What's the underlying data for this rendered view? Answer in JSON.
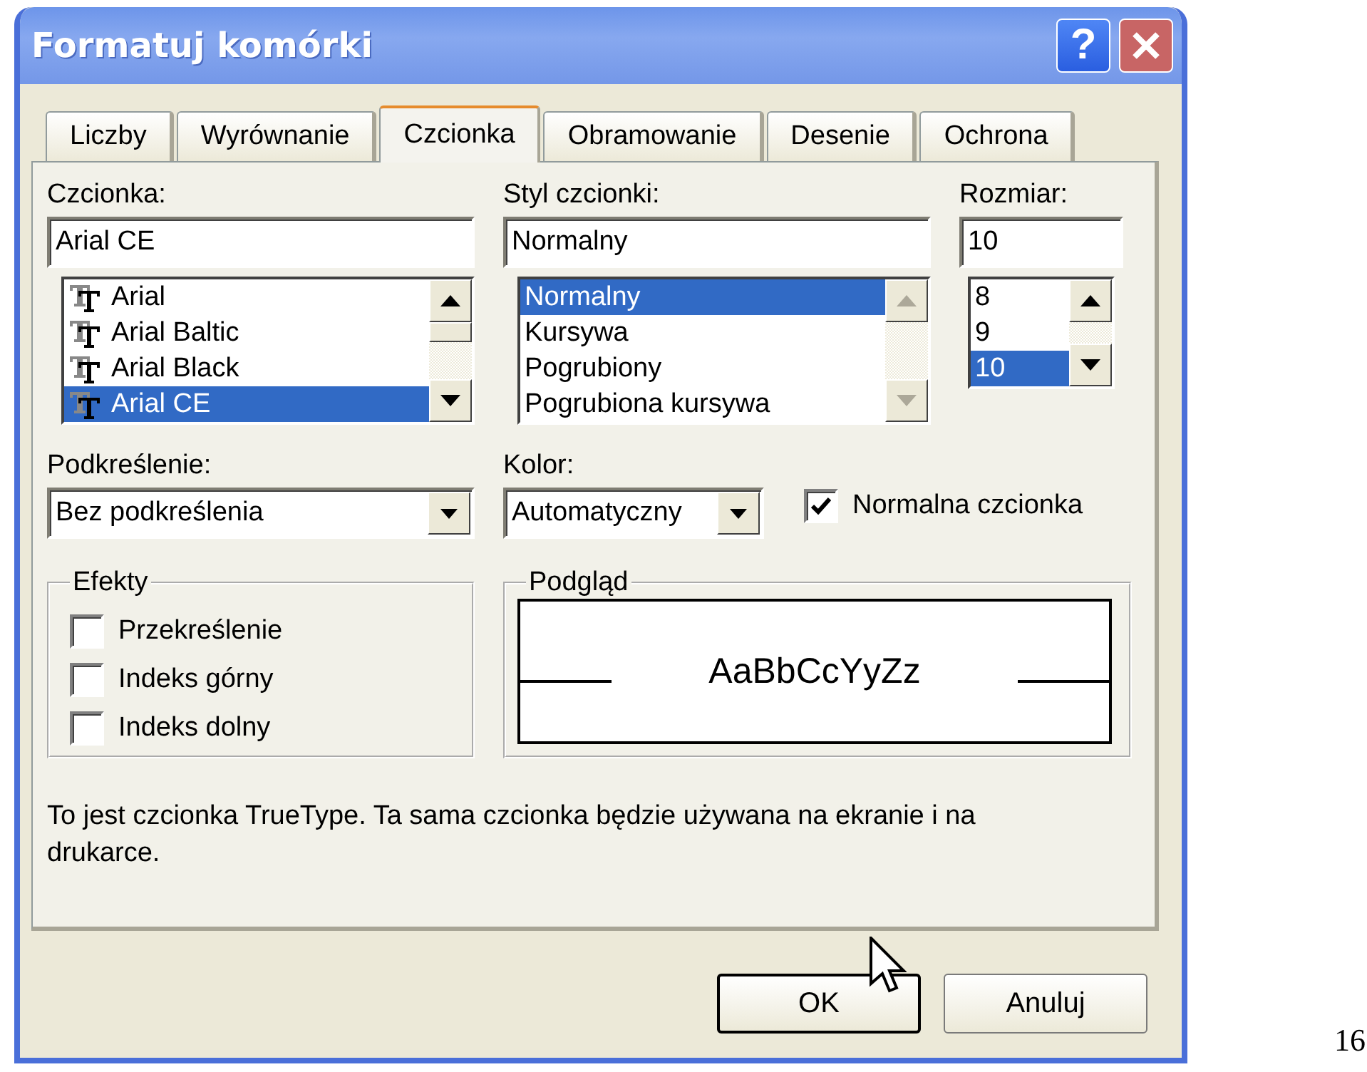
{
  "window": {
    "title": "Formatuj komórki",
    "help_button": "?"
  },
  "tabs": [
    {
      "label": "Liczby",
      "selected": false
    },
    {
      "label": "Wyrównanie",
      "selected": false
    },
    {
      "label": "Czcionka",
      "selected": true
    },
    {
      "label": "Obramowanie",
      "selected": false
    },
    {
      "label": "Desenie",
      "selected": false
    },
    {
      "label": "Ochrona",
      "selected": false
    }
  ],
  "font": {
    "label": "Czcionka:",
    "value": "Arial CE",
    "scroll_enabled": true,
    "items": [
      {
        "label": "Arial",
        "selected": false
      },
      {
        "label": "Arial Baltic",
        "selected": false
      },
      {
        "label": "Arial Black",
        "selected": false
      },
      {
        "label": "Arial CE",
        "selected": true
      }
    ]
  },
  "style": {
    "label": "Styl czcionki:",
    "value": "Normalny",
    "scroll_enabled": false,
    "items": [
      {
        "label": "Normalny",
        "selected": true
      },
      {
        "label": "Kursywa",
        "selected": false
      },
      {
        "label": "Pogrubiony",
        "selected": false
      },
      {
        "label": "Pogrubiona kursywa",
        "selected": false
      }
    ]
  },
  "size": {
    "label": "Rozmiar:",
    "value": "10",
    "scroll_enabled": true,
    "items": [
      {
        "label": "8",
        "selected": false
      },
      {
        "label": "9",
        "selected": false
      },
      {
        "label": "10",
        "selected": true
      }
    ]
  },
  "underline": {
    "label": "Podkreślenie:",
    "value": "Bez podkreślenia"
  },
  "color": {
    "label": "Kolor:",
    "value": "Automatyczny"
  },
  "normal_font": {
    "label": "Normalna czcionka",
    "checked": true
  },
  "effects": {
    "title": "Efekty",
    "options": [
      {
        "label": "Przekreślenie",
        "checked": false
      },
      {
        "label": "Indeks górny",
        "checked": false
      },
      {
        "label": "Indeks dolny",
        "checked": false
      }
    ]
  },
  "preview": {
    "title": "Podgląd",
    "sample": "AaBbCcYyZz"
  },
  "info": "To jest czcionka TrueType. Ta sama czcionka będzie używana na ekranie i na drukarce.",
  "buttons": [
    {
      "label": "OK",
      "default": true
    },
    {
      "label": "Anuluj",
      "default": false
    }
  ],
  "page_number": "16"
}
